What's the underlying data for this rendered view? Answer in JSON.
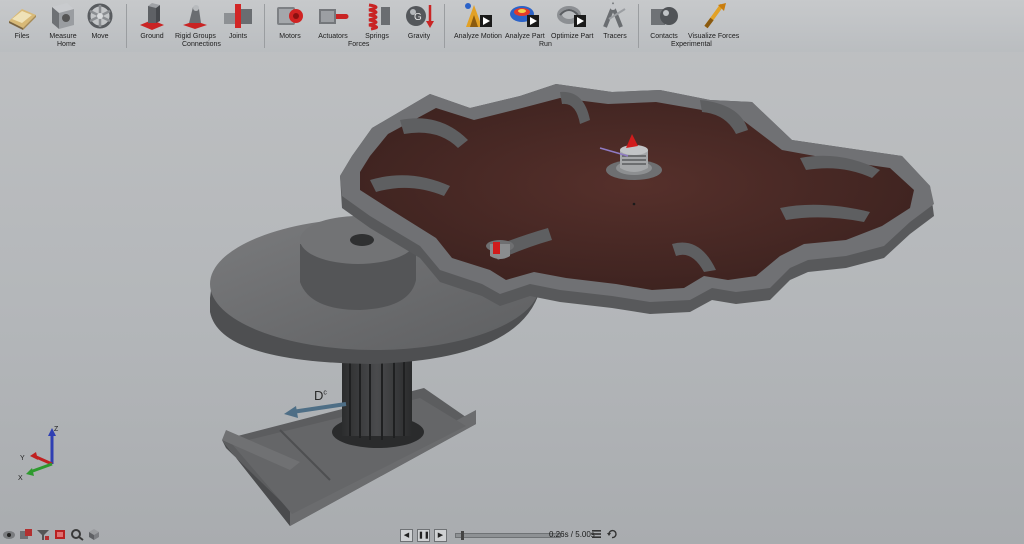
{
  "ribbon": {
    "home": {
      "group_label": "Home",
      "tools": [
        {
          "label": "Files",
          "icon": "folder-icon"
        },
        {
          "label": "Measure",
          "icon": "measure-icon"
        },
        {
          "label": "Move",
          "icon": "move-icon"
        }
      ]
    },
    "connections": {
      "group_label": "Connections",
      "tools": [
        {
          "label": "Ground",
          "icon": "ground-icon"
        },
        {
          "label": "Rigid Groups",
          "icon": "rigid-groups-icon"
        },
        {
          "label": "Joints",
          "icon": "joints-icon"
        }
      ]
    },
    "forces": {
      "group_label": "Forces",
      "tools": [
        {
          "label": "Motors",
          "icon": "motor-icon"
        },
        {
          "label": "Actuators",
          "icon": "actuator-icon"
        },
        {
          "label": "Springs",
          "icon": "spring-icon"
        },
        {
          "label": "Gravity",
          "icon": "gravity-icon"
        }
      ]
    },
    "run": {
      "group_label": "Run",
      "tools": [
        {
          "label": "Analyze Motion",
          "icon": "analyze-motion-icon"
        },
        {
          "label": "Analyze Part",
          "icon": "analyze-part-icon"
        },
        {
          "label": "Optimize Part",
          "icon": "optimize-part-icon"
        },
        {
          "label": "Tracers",
          "icon": "tracers-icon"
        }
      ]
    },
    "experimental": {
      "group_label": "Experimental",
      "tools": [
        {
          "label": "Contacts",
          "icon": "contacts-icon"
        },
        {
          "label": "Visualize Forces",
          "icon": "visualize-forces-icon"
        }
      ]
    }
  },
  "viewport": {
    "dimension_label": "D",
    "dimension_sup": "c",
    "axis_z": "Z",
    "axis_y": "Y",
    "axis_x": "X"
  },
  "playback": {
    "time": "0.26s / 5.00s",
    "progress": 0.052
  },
  "colors": {
    "ribbon_bg": "#c2c4c6",
    "viewport_bg": "#b6b9bc",
    "part_gray": "#6b6c6e",
    "face_brown": "#4a2a26",
    "accent_red": "#d01c1c"
  }
}
